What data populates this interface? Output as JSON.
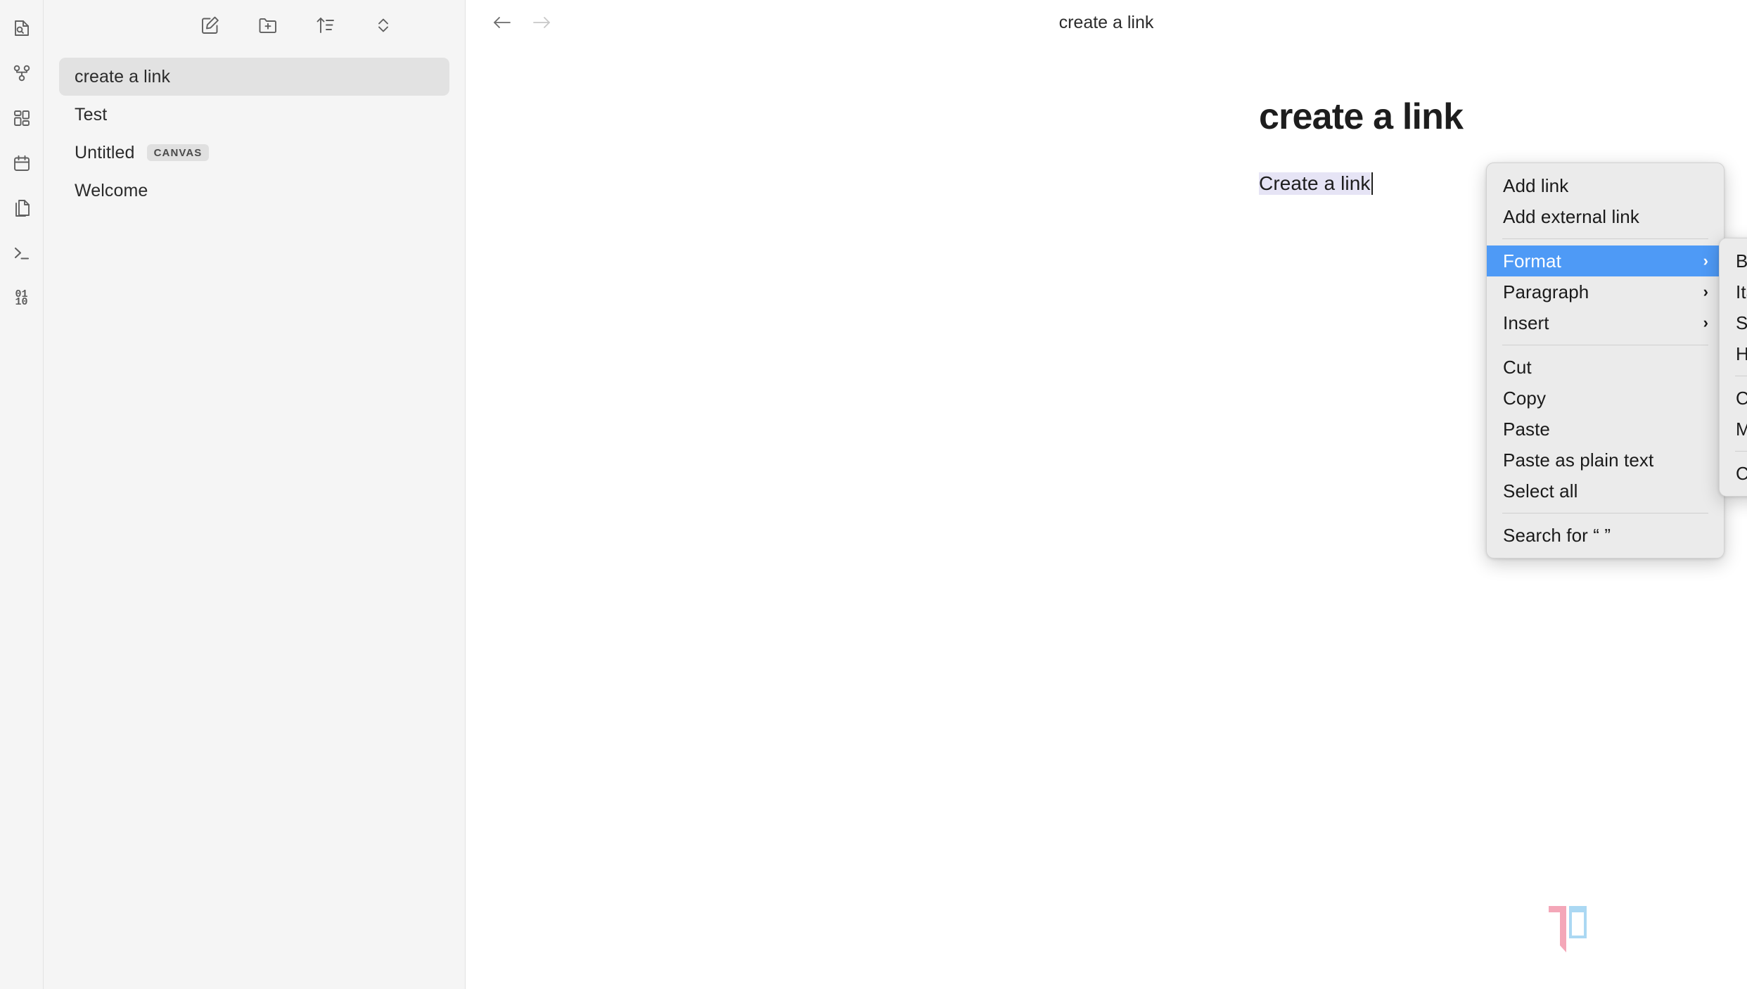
{
  "rail": {
    "items": [
      {
        "name": "file-search-icon",
        "label": "Search files"
      },
      {
        "name": "graph-view-icon",
        "label": "Graph view"
      },
      {
        "name": "dashboard-grid-icon",
        "label": "Dashboard"
      },
      {
        "name": "calendar-icon",
        "label": "Calendar"
      },
      {
        "name": "duplicate-pages-icon",
        "label": "Pages"
      },
      {
        "name": "terminal-icon",
        "label": "Terminal"
      },
      {
        "name": "binary-icon",
        "label": "01 10"
      }
    ],
    "binary_top": "01",
    "binary_bottom": "10"
  },
  "sidebar": {
    "toolbar": [
      {
        "name": "new-note-icon",
        "label": "New note"
      },
      {
        "name": "new-folder-icon",
        "label": "New folder"
      },
      {
        "name": "sort-ascending-icon",
        "label": "Sort"
      },
      {
        "name": "expand-collapse-icon",
        "label": "Expand all"
      }
    ],
    "notes": [
      {
        "title": "create a link",
        "badge": "",
        "selected": true
      },
      {
        "title": "Test",
        "badge": "",
        "selected": false
      },
      {
        "title": "Untitled",
        "badge": "CANVAS",
        "selected": false
      },
      {
        "title": "Welcome",
        "badge": "",
        "selected": false
      }
    ]
  },
  "topbar": {
    "back_label": "Back",
    "forward_label": "Forward",
    "title": "create a link"
  },
  "document": {
    "title": "create a link",
    "body_text": "Create a link"
  },
  "context_menu": {
    "groups": [
      {
        "items": [
          {
            "label": "Add link",
            "submenu": false,
            "highlight": false
          },
          {
            "label": "Add external link",
            "submenu": false,
            "highlight": false
          }
        ]
      },
      {
        "items": [
          {
            "label": "Format",
            "submenu": true,
            "highlight": true
          },
          {
            "label": "Paragraph",
            "submenu": true,
            "highlight": false
          },
          {
            "label": "Insert",
            "submenu": true,
            "highlight": false
          }
        ]
      },
      {
        "items": [
          {
            "label": "Cut",
            "submenu": false,
            "highlight": false
          },
          {
            "label": "Copy",
            "submenu": false,
            "highlight": false
          },
          {
            "label": "Paste",
            "submenu": false,
            "highlight": false
          },
          {
            "label": "Paste as plain text",
            "submenu": false,
            "highlight": false
          },
          {
            "label": "Select all",
            "submenu": false,
            "highlight": false
          }
        ]
      },
      {
        "items": [
          {
            "label": "Search for “ ”",
            "submenu": false,
            "highlight": false
          }
        ]
      }
    ]
  },
  "submenu": {
    "groups": [
      {
        "items": [
          {
            "label": "Bold"
          },
          {
            "label": "Italic"
          },
          {
            "label": "Strikethrough"
          },
          {
            "label": "Highlight"
          }
        ]
      },
      {
        "items": [
          {
            "label": "Code"
          },
          {
            "label": "Math"
          }
        ]
      },
      {
        "items": [
          {
            "label": "Clear formatting"
          }
        ]
      }
    ]
  },
  "watermark": {
    "text": "XDA",
    "bracket_left_color": "#f4a0b3",
    "bracket_right_color": "#93cdf0"
  },
  "colors": {
    "accent_highlight": "#4e9af6",
    "sidebar_bg": "#f5f5f5",
    "menu_bg": "#ebebeb",
    "selected_note_bg": "#e2e2e2"
  }
}
